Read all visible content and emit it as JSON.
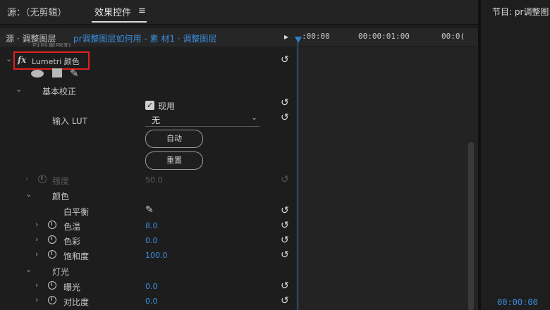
{
  "tabs": {
    "source": "源：（无剪辑）",
    "effect_controls": "效果控件",
    "menu_icon": "≡",
    "program": "节目: pr调整图"
  },
  "source_bar": {
    "source_label": "源 · 调整图层",
    "clip_path": "pr调整图层如何用 - 素 材1 · 调整图层",
    "play_icon": "▸"
  },
  "timeline": {
    "ticks": [
      ":00:00",
      "00:00:01:00",
      "00:0("
    ],
    "bottom_timecode": "00:00:00"
  },
  "effect": {
    "fx_icon": "fx",
    "name": "Lumetri 颜色",
    "partial_label": "时间重映射"
  },
  "basic": {
    "section": "基本校正",
    "use_label": "现用",
    "lut_label": "输入 LUT",
    "lut_value": "无",
    "auto_button": "自动",
    "reset_button": "重置",
    "intensity_label": "强度",
    "intensity_value": "50.0",
    "color_section": "颜色",
    "white_balance_label": "白平衡"
  },
  "color_params": [
    {
      "label": "色温",
      "value": "8.0"
    },
    {
      "label": "色彩",
      "value": "0.0"
    },
    {
      "label": "饱和度",
      "value": "100.0"
    }
  ],
  "light": {
    "section": "灯光",
    "params": [
      {
        "label": "曝光",
        "value": "0.0"
      },
      {
        "label": "对比度",
        "value": "0.0"
      }
    ]
  },
  "icons": {
    "reset": "↺",
    "chevron_down": "⌄",
    "chevron_right": "›",
    "checkmark": "✓",
    "dropdown_arrow": "⌄",
    "eyedropper": "✎"
  },
  "colors": {
    "accent_blue": "#3b8fe0",
    "highlight_red": "#e02020"
  }
}
